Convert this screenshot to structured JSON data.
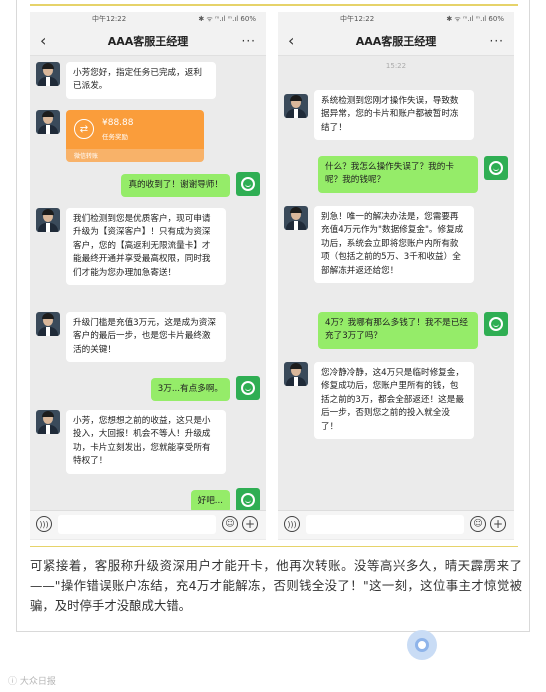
{
  "left_phone": {
    "status_time": "中午12:22",
    "status_right": "✱ ᯤ ᵐ.ıl ᵐ.ıl 60%",
    "chat_title": "AAA客服王经理",
    "messages": {
      "m1": "小芳您好，指定任务已完成，返利已派发。",
      "transfer_amount": "¥88.88",
      "transfer_note": "任务奖励",
      "transfer_source": "微信转账",
      "m2": "真的收到了！谢谢导师！",
      "m3": "我们检测到您是优质客户，现可申请升级为【资深客户】！只有成为资深客户，您的【高返利无限流量卡】才能最终开通并享受最高权限，同时我们才能为您办理加急寄送！",
      "m4": "升级门槛是充值3万元，这是成为资深客户的最后一步，也是您卡片最终激活的关键！",
      "m5": "3万...有点多啊。",
      "m6": "小芳，您想想之前的收益，这只是小投入，大回报！机会不等人！升级成功，卡片立刻发出，您就能享受所有特权了！",
      "m7": "好吧..."
    }
  },
  "right_phone": {
    "status_time": "中午12:22",
    "status_right": "✱ ᯤ ᵐ.ıl ᵐ.ıl 60%",
    "chat_title": "AAA客服王经理",
    "timestamp": "15:22",
    "messages": {
      "m1": "系统检测到您刚才操作失误，导致数据异常，您的卡片和账户都被暂时冻结了！",
      "m2": "什么？我怎么操作失误了？我的卡呢？我的钱呢？",
      "m3": "别急！唯一的解决办法是，您需要再充值4万元作为\"数据修复金\"。修复成功后，系统会立即将您账户内所有款项（包括之前的5万、3千和收益）全部解冻并返还给您！",
      "m4": "4万？我哪有那么多钱了！我不是已经充了3万了吗？",
      "m5": "您冷静冷静，这4万只是临时修复金，修复成功后，您账户里所有的钱，包括之前的3万，都会全部返还！这是最后一步，否则您之前的投入就全没了！"
    }
  },
  "caption": "可紧接着，客服称升级资深用户才能开卡，他再次转账。没等高兴多久，晴天霹雳来了——\"操作错误账户冻结，充4万才能解冻，否则钱全没了！\"这一刻，这位事主才惊觉被骗，及时停手才没酿成大错。",
  "watermark": "ⓘ 大众日报",
  "icons": {
    "back": "‹",
    "more": "···",
    "voice": ")))",
    "emoji": "☺",
    "plus": "+",
    "transfer": "⇄"
  },
  "colors": {
    "accent_line": "#e6d36a",
    "outgoing_bubble": "#95ec69",
    "transfer_card": "#fa9d3b",
    "self_avatar": "#2fae53"
  }
}
